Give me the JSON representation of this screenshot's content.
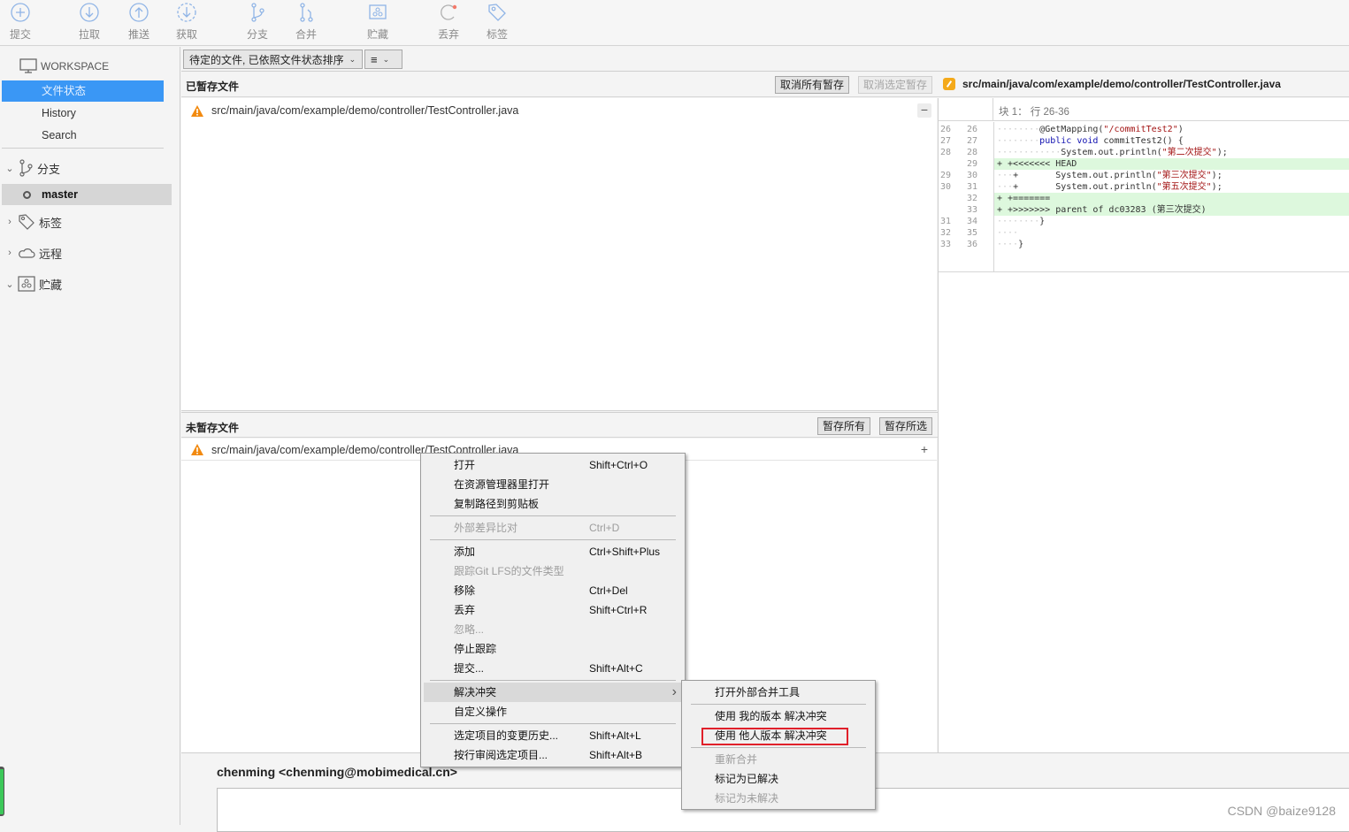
{
  "toolbar": {
    "buttons": [
      {
        "id": "commit",
        "label": "提交",
        "icon": "plus-circle-icon"
      },
      {
        "id": "pull",
        "label": "拉取",
        "icon": "arrow-down-circle-icon"
      },
      {
        "id": "push",
        "label": "推送",
        "icon": "arrow-up-circle-icon"
      },
      {
        "id": "fetch",
        "label": "获取",
        "icon": "arrow-down-dashed-circle-icon"
      },
      {
        "id": "branch",
        "label": "分支",
        "icon": "branch-icon"
      },
      {
        "id": "merge",
        "label": "合并",
        "icon": "merge-icon"
      },
      {
        "id": "stash",
        "label": "贮藏",
        "icon": "stash-icon"
      },
      {
        "id": "discard",
        "label": "丢弃",
        "icon": "discard-icon"
      },
      {
        "id": "tag",
        "label": "标签",
        "icon": "tag-icon"
      }
    ]
  },
  "sidebar": {
    "workspace_label": "WORKSPACE",
    "workspace_items": [
      {
        "label": "文件状态",
        "active": true
      },
      {
        "label": "History",
        "active": false
      },
      {
        "label": "Search",
        "active": false
      }
    ],
    "groups": {
      "branches": {
        "label": "分支",
        "expanded": true
      },
      "tags": {
        "label": "标签",
        "expanded": false
      },
      "remotes": {
        "label": "远程",
        "expanded": false
      },
      "stashes": {
        "label": "贮藏",
        "expanded": true
      }
    },
    "current_branch": "master"
  },
  "filterbar": {
    "sort_dropdown": "待定的文件, 已依照文件状态排序",
    "view_dropdown_icon": "list-icon"
  },
  "staged": {
    "title": "已暂存文件",
    "unstage_all": "取消所有暂存",
    "unstage_selected": "取消选定暂存",
    "files": [
      {
        "path": "src/main/java/com/example/demo/controller/TestController.java",
        "status": "conflict"
      }
    ]
  },
  "unstaged": {
    "title": "未暂存文件",
    "stage_all": "暂存所有",
    "stage_selected": "暂存所选",
    "files": [
      {
        "path": "src/main/java/com/example/demo/controller/TestController.java",
        "status": "conflict"
      }
    ]
  },
  "diff": {
    "file_path": "src/main/java/com/example/demo/controller/TestController.java",
    "hunk_label": "块 1： 行 26-36",
    "lines": [
      {
        "old": "26",
        "new": "26",
        "type": "ctx",
        "text": "@GetMapping(\"/commitTest2\")"
      },
      {
        "old": "27",
        "new": "27",
        "type": "ctx",
        "text": "public void commitTest2() {"
      },
      {
        "old": "28",
        "new": "28",
        "type": "ctx",
        "text": "System.out.println(\"第二次提交\");"
      },
      {
        "old": "",
        "new": "29",
        "type": "add",
        "text": "+ +<<<<<<< HEAD"
      },
      {
        "old": "29",
        "new": "30",
        "type": "ctx",
        "text": "+       System.out.println(\"第三次提交\");"
      },
      {
        "old": "30",
        "new": "31",
        "type": "ctx",
        "text": "+       System.out.println(\"第五次提交\");"
      },
      {
        "old": "",
        "new": "32",
        "type": "add",
        "text": "+ +======="
      },
      {
        "old": "",
        "new": "33",
        "type": "add",
        "text": "+ +>>>>>>> parent of dc03283 (第三次提交)"
      },
      {
        "old": "31",
        "new": "34",
        "type": "ctx",
        "text": "}"
      },
      {
        "old": "32",
        "new": "35",
        "type": "ctx",
        "text": ""
      },
      {
        "old": "33",
        "new": "36",
        "type": "ctx",
        "text": "}"
      }
    ]
  },
  "context_menu": {
    "items": [
      {
        "label": "打开",
        "shortcut": "Shift+Ctrl+O",
        "disabled": false
      },
      {
        "label": "在资源管理器里打开",
        "shortcut": "",
        "disabled": false
      },
      {
        "label": "复制路径到剪贴板",
        "shortcut": "",
        "disabled": false
      },
      {
        "label": "外部差异比对",
        "shortcut": "Ctrl+D",
        "disabled": true
      },
      {
        "label": "添加",
        "shortcut": "Ctrl+Shift+Plus",
        "disabled": false
      },
      {
        "label": "跟踪Git LFS的文件类型",
        "shortcut": "",
        "disabled": true
      },
      {
        "label": "移除",
        "shortcut": "Ctrl+Del",
        "disabled": false
      },
      {
        "label": "丢弃",
        "shortcut": "Shift+Ctrl+R",
        "disabled": false
      },
      {
        "label": "忽略...",
        "shortcut": "",
        "disabled": true
      },
      {
        "label": "停止跟踪",
        "shortcut": "",
        "disabled": false
      },
      {
        "label": "提交...",
        "shortcut": "Shift+Alt+C",
        "disabled": false
      },
      {
        "label": "解决冲突",
        "shortcut": "",
        "disabled": false,
        "submenu": true,
        "highlighted": true
      },
      {
        "label": "自定义操作",
        "shortcut": "",
        "disabled": false
      },
      {
        "label": "选定项目的变更历史...",
        "shortcut": "Shift+Alt+L",
        "disabled": false
      },
      {
        "label": "按行审阅选定项目...",
        "shortcut": "Shift+Alt+B",
        "disabled": false
      }
    ]
  },
  "submenu": {
    "items": [
      {
        "label": "打开外部合并工具",
        "disabled": false
      },
      {
        "label": "使用 我的版本 解决冲突",
        "disabled": false
      },
      {
        "label": "使用 他人版本 解决冲突",
        "disabled": false,
        "annotated": true
      },
      {
        "label": "重新合并",
        "disabled": true
      },
      {
        "label": "标记为已解决",
        "disabled": false
      },
      {
        "label": "标记为未解决",
        "disabled": true
      }
    ],
    "annotation_color": "#e0202a"
  },
  "commit": {
    "author": "chenming <chenming@mobimedical.cn>",
    "message": ""
  },
  "watermark": "CSDN @baize9128",
  "colors": {
    "accent": "#3a97f5",
    "added_line_bg": "#ddf8dd",
    "conflict_icon": "#f28a10"
  }
}
